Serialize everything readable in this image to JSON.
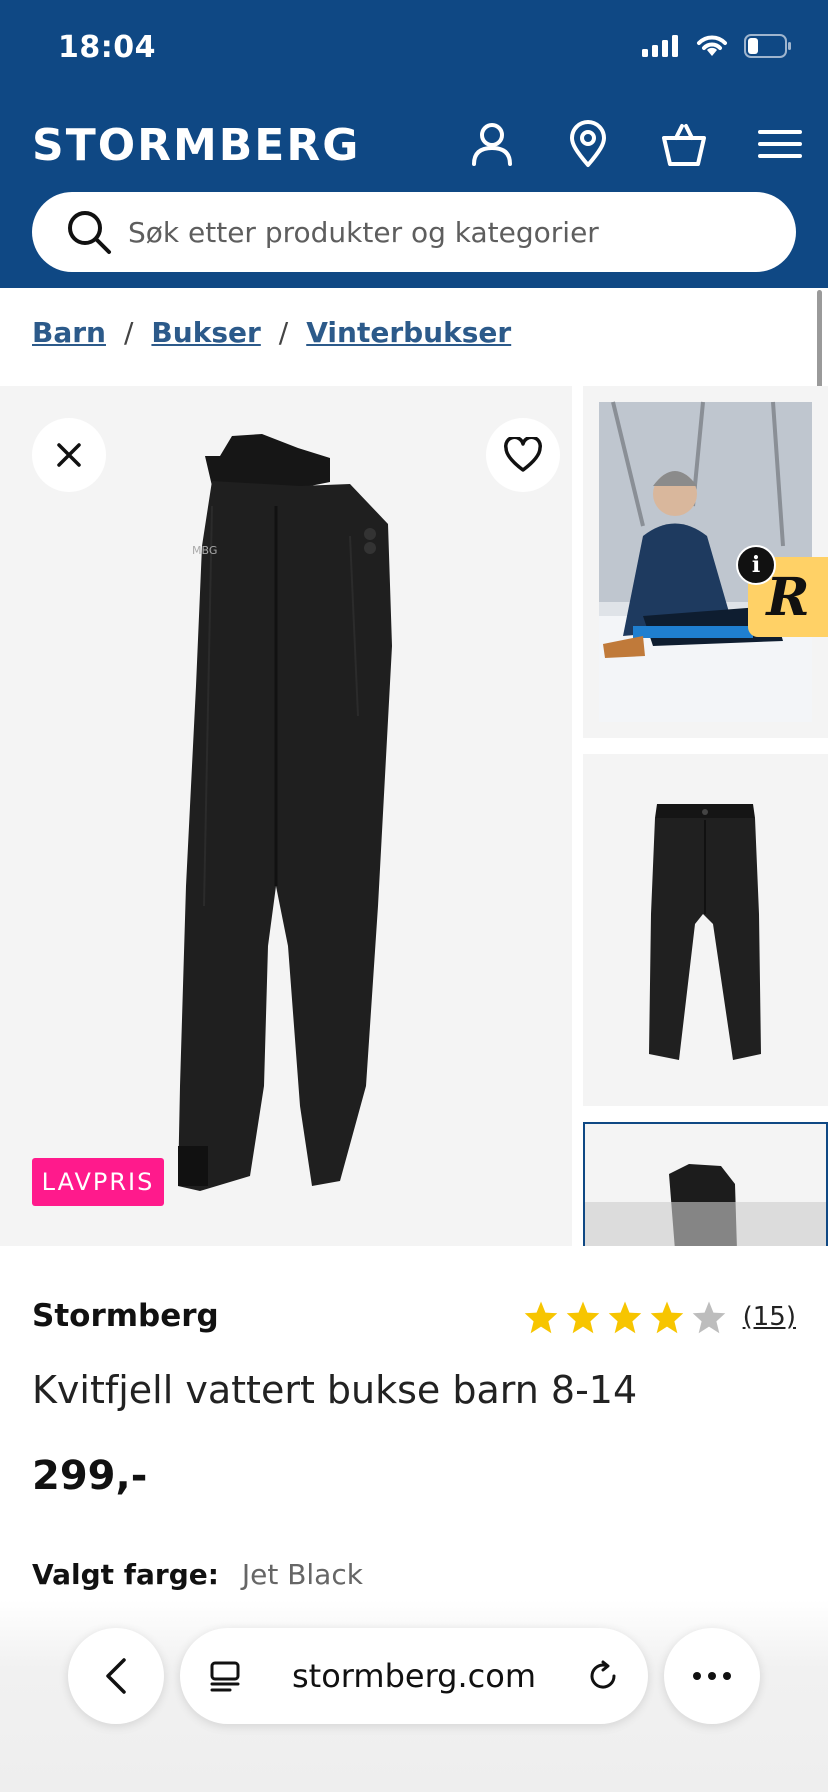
{
  "status_bar": {
    "time": "18:04",
    "battery_icon": "battery-low-icon",
    "wifi_icon": "wifi-icon",
    "signal_icon": "cellular-signal-icon"
  },
  "header": {
    "logo": "STORMBERG",
    "icons": [
      "user-icon",
      "location-pin-icon",
      "shopping-bag-icon",
      "hamburger-menu-icon"
    ],
    "search_placeholder": "Søk etter produkter og kategorier",
    "background": "#0f4884"
  },
  "breadcrumb": [
    {
      "label": "Barn"
    },
    {
      "label": "Bukser"
    },
    {
      "label": "Vinterbukser"
    }
  ],
  "breadcrumb_separator": "/",
  "gallery": {
    "badge": "LAVPRIS",
    "badge_color": "#ff1a8c",
    "thumb_count_visible": 3,
    "overlay_widget_letter": "R",
    "overlay_info": "i"
  },
  "product": {
    "brand": "Stormberg",
    "rating": 4,
    "rating_max": 5,
    "review_count": "(15)",
    "title": "Kvitfjell vattert bukse barn 8-14",
    "price": "299,-",
    "color_label": "Valgt farge:",
    "color_value": "Jet Black"
  },
  "browser": {
    "url": "stormberg.com",
    "back_icon": "chevron-left-icon",
    "tabs_icon": "reader-icon",
    "reload_icon": "reload-icon",
    "more_icon": "more-dots-icon"
  }
}
